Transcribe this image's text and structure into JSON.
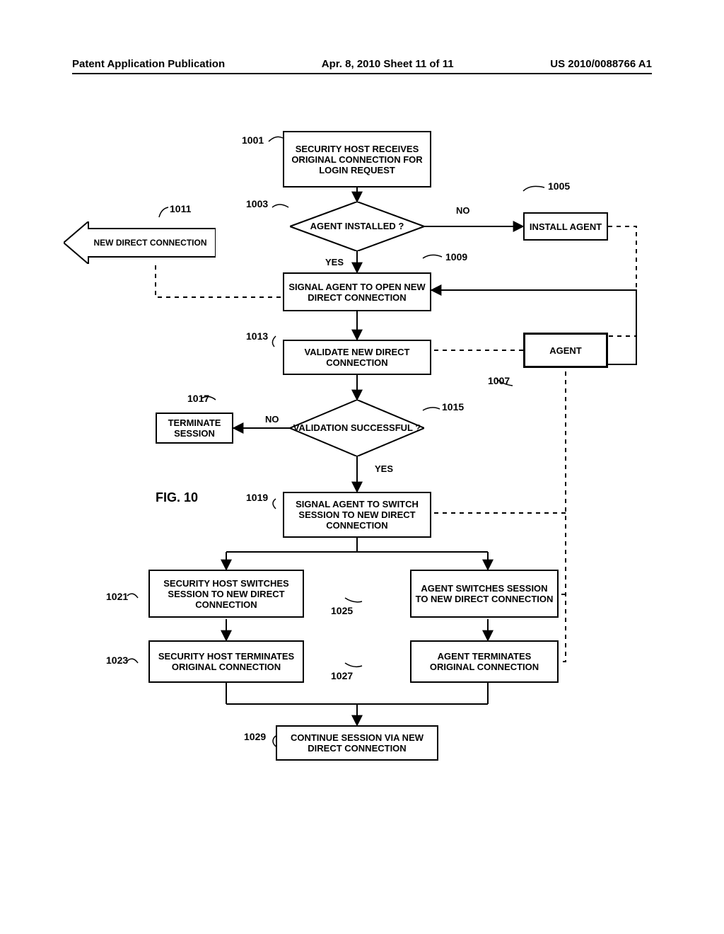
{
  "header": {
    "left": "Patent Application Publication",
    "center": "Apr. 8, 2010  Sheet 11 of 11",
    "right": "US 2010/0088766 A1"
  },
  "figure_label": "FIG. 10",
  "nodes": {
    "n1001": "SECURITY HOST RECEIVES ORIGINAL CONNECTION FOR LOGIN REQUEST",
    "n1003": "AGENT INSTALLED ?",
    "n1005": "INSTALL AGENT",
    "n1007": "AGENT",
    "n1009": "SIGNAL AGENT TO OPEN NEW DIRECT CONNECTION",
    "n1011": "NEW DIRECT CONNECTION",
    "n1013": "VALIDATE NEW DIRECT CONNECTION",
    "n1015": "VALIDATION SUCCESSFUL ?",
    "n1017": "TERMINATE SESSION",
    "n1019": "SIGNAL AGENT TO SWITCH SESSION TO NEW DIRECT CONNECTION",
    "n1021": "SECURITY HOST SWITCHES SESSION TO NEW DIRECT CONNECTION",
    "n1023": "SECURITY HOST TERMINATES ORIGINAL CONNECTION",
    "n1025": "AGENT SWITCHES SESSION TO NEW DIRECT CONNECTION",
    "n1027": "AGENT TERMINATES ORIGINAL CONNECTION",
    "n1029": "CONTINUE SESSION VIA NEW DIRECT CONNECTION"
  },
  "refs": {
    "r1001": "1001",
    "r1003": "1003",
    "r1005": "1005",
    "r1007": "1007",
    "r1009": "1009",
    "r1011": "1011",
    "r1013": "1013",
    "r1015": "1015",
    "r1017": "1017",
    "r1019": "1019",
    "r1021": "1021",
    "r1023": "1023",
    "r1025": "1025",
    "r1027": "1027",
    "r1029": "1029"
  },
  "edge_labels": {
    "no1": "NO",
    "yes1": "YES",
    "no2": "NO",
    "yes2": "YES"
  }
}
